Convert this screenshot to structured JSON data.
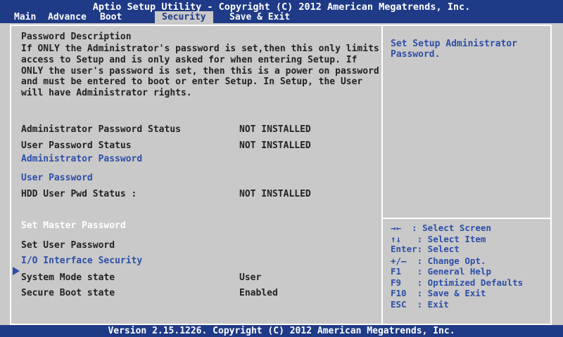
{
  "header": {
    "title": "Aptio Setup Utility - Copyright (C) 2012 American Megatrends, Inc.",
    "tabs": [
      "Main",
      "Advance",
      "Boot",
      "Security",
      "Save & Exit"
    ]
  },
  "main": {
    "section_title": "Password Description",
    "description": "If ONLY the Administrator's password is set,then this only limits access to Setup and is only asked for when entering Setup. If ONLY the user's password is set, then this is a power on password and must be entered to boot or enter Setup. In Setup, the User will have Administrator rights.",
    "admin_status_label": "Administrator Password Status",
    "admin_status_value": "NOT INSTALLED",
    "user_status_label": "User Password Status",
    "user_status_value": "NOT INSTALLED",
    "admin_password": "Administrator Password",
    "user_password": "User Password",
    "hdd_status_label": "HDD User Pwd Status :",
    "hdd_status_value": "NOT INSTALLED",
    "set_master": "Set Master Password",
    "set_user": "Set User Password",
    "io_security": "I/O Interface Security",
    "system_mode_label": "System Mode state",
    "system_mode_value": "User",
    "secure_boot_label": "Secure Boot state",
    "secure_boot_value": "Enabled"
  },
  "side": {
    "help_text": "Set Setup Administrator\nPassword.",
    "keys": [
      "→←  : Select Screen",
      "↑↓   : Select Item",
      "Enter: Select",
      "+/—  : Change Opt.",
      "F1   : General Help",
      "F9   : Optimized Defaults",
      "F10  : Save & Exit",
      "ESC  : Exit"
    ]
  },
  "footer": {
    "version": "Version 2.15.1226. Copyright (C) 2012 American Megatrends, Inc."
  },
  "colors": {
    "header_bg": "#1f3a86",
    "panel_bg": "#c9c9c9",
    "link_blue": "#2c4fa8"
  }
}
